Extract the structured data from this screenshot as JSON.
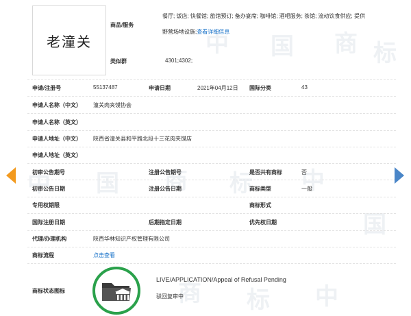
{
  "trademark": {
    "name": "老潼关"
  },
  "goods_services": {
    "label": "商品/服务",
    "line1": "餐厅; 饭店; 快餐馆; 旅馆预订; 备办宴席; 咖啡馆; 酒吧服务; 茶馆; 流动饮食供应; 提供",
    "line2": "野营场地设施;",
    "detail_link": "查看详细信息"
  },
  "similar_group": {
    "label": "类似群",
    "value": "4301;4302;"
  },
  "fields": {
    "reg_no_label": "申请/注册号",
    "reg_no": "55137487",
    "app_date_label": "申请日期",
    "app_date": "2021年04月12日",
    "intl_class_label": "国际分类",
    "intl_class": "43",
    "applicant_cn_label": "申请人名称（中文）",
    "applicant_cn": "潼关肉夹馍协会",
    "applicant_en_label": "申请人名称（英文）",
    "address_cn_label": "申请人地址（中文）",
    "address_cn": "陕西省潼关县和平路北段十三花肉夹馍店",
    "address_en_label": "申请人地址（英文）",
    "prelim_no_label": "初审公告期号",
    "reg_pub_no_label": "注册公告期号",
    "shared_label": "是否共有商标",
    "shared": "否",
    "prelim_date_label": "初审公告日期",
    "reg_pub_date_label": "注册公告日期",
    "tm_type_label": "商标类型",
    "tm_type": "一般",
    "exclusive_label": "专用权期限",
    "tm_form_label": "商标形式",
    "intl_reg_date_label": "国际注册日期",
    "later_date_label": "后期指定日期",
    "priority_date_label": "优先权日期",
    "agent_label": "代理/办理机构",
    "agent": "陕西华林知识产权管理有限公司",
    "process_label": "商标流程",
    "process_link": "点击查看",
    "status_label": "商标状态图标"
  },
  "status": {
    "en": "LIVE/APPLICATION/Appeal of Refusal Pending",
    "cn": "驳回复审中"
  },
  "watermark": {
    "glyphs": [
      "中",
      "国",
      "商",
      "标"
    ]
  },
  "colors": {
    "link": "#1a73c9",
    "status_ring": "#2aa14b",
    "arrow_left": "#f39a1e",
    "arrow_right": "#4a86c8"
  },
  "icons": {
    "prev": "chevron-left-icon",
    "next": "chevron-right-icon",
    "status": "folder-institution-icon"
  }
}
